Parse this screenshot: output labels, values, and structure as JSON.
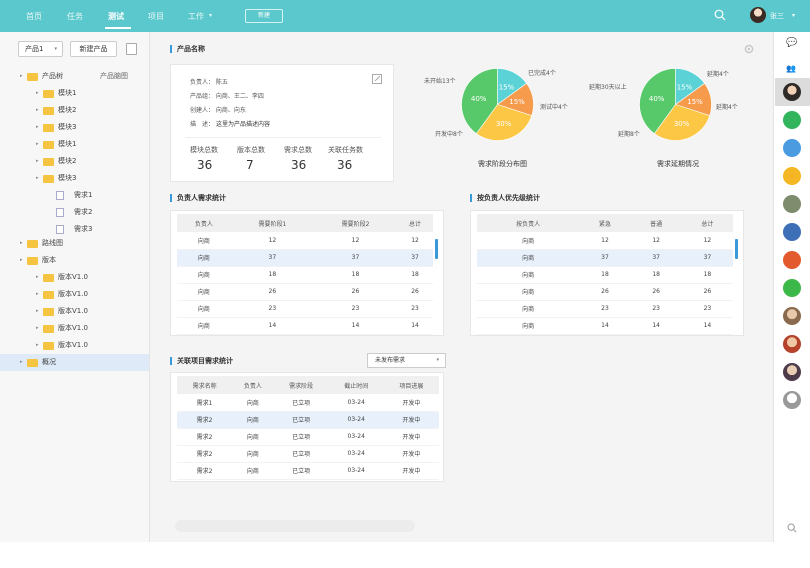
{
  "nav": {
    "items": [
      "首页",
      "任务",
      "测试",
      "项目",
      "工作"
    ],
    "active": "测试",
    "work_caret": "▾",
    "new_button": "新建",
    "user_name": "张三",
    "user_caret": "▾"
  },
  "sidebar": {
    "product_select": "产品1",
    "select_caret": "▾",
    "new_product_button": "新建产品",
    "tree": [
      {
        "label": "产品树",
        "level": 0,
        "type": "folder",
        "right": "产品脑图"
      },
      {
        "label": "模块1",
        "level": 1,
        "type": "folder"
      },
      {
        "label": "模块2",
        "level": 1,
        "type": "folder"
      },
      {
        "label": "模块3",
        "level": 1,
        "type": "folder"
      },
      {
        "label": "模块1",
        "level": 1,
        "type": "folder"
      },
      {
        "label": "模块2",
        "level": 1,
        "type": "folder"
      },
      {
        "label": "模块3",
        "level": 1,
        "type": "folder"
      },
      {
        "label": "需求1",
        "level": 2,
        "type": "file"
      },
      {
        "label": "需求2",
        "level": 2,
        "type": "file"
      },
      {
        "label": "需求3",
        "level": 2,
        "type": "file"
      },
      {
        "label": "路线图",
        "level": 0,
        "type": "folder"
      },
      {
        "label": "版本",
        "level": 0,
        "type": "folder"
      },
      {
        "label": "版本V1.0",
        "level": 1,
        "type": "folder"
      },
      {
        "label": "版本V1.0",
        "level": 1,
        "type": "folder"
      },
      {
        "label": "版本V1.0",
        "level": 1,
        "type": "folder"
      },
      {
        "label": "版本V1.0",
        "level": 1,
        "type": "folder"
      },
      {
        "label": "版本V1.0",
        "level": 1,
        "type": "folder"
      },
      {
        "label": "概况",
        "level": 0,
        "type": "folder",
        "selected": true
      }
    ]
  },
  "product": {
    "section_title": "产品名称",
    "owner": "负责人：   陈五",
    "group": "产品组：   向商、王二、李四",
    "creator": "创建人：   向商、向东",
    "desc_label": "描　述：",
    "desc_value": "这里为产品描述内容",
    "stats": [
      {
        "label": "模块总数",
        "value": "36"
      },
      {
        "label": "版本总数",
        "value": "7"
      },
      {
        "label": "需求总数",
        "value": "36"
      },
      {
        "label": "关联任务数",
        "value": "36"
      }
    ]
  },
  "pies": [
    {
      "caption": "需求阶段分布图",
      "slices": [
        {
          "label": "已完成4个",
          "pct": "15%",
          "value": 15,
          "color": "#5bd3d6"
        },
        {
          "label": "测试中4个",
          "pct": "15%",
          "value": 15,
          "color": "#f69a4c"
        },
        {
          "label": "开发中8个",
          "pct": "30%",
          "value": 30,
          "color": "#fcc745"
        },
        {
          "label": "未开始13个",
          "pct": "40%",
          "value": 40,
          "color": "#58c96b"
        }
      ]
    },
    {
      "caption": "需求延期情况",
      "slices": [
        {
          "label": "延期4个",
          "pct": "15%",
          "value": 15,
          "color": "#5bd3d6"
        },
        {
          "label": "延期4个",
          "pct": "15%",
          "value": 15,
          "color": "#f69a4c"
        },
        {
          "label": "延期8个",
          "pct": "30%",
          "value": 30,
          "color": "#fcc745"
        },
        {
          "label": "延期30天以上",
          "pct": "40%",
          "value": 40,
          "color": "#58c96b"
        }
      ]
    }
  ],
  "owner_table": {
    "title": "负责人需求统计",
    "headers": [
      "负责人",
      "需要阶段1",
      "需要阶段2",
      "总计"
    ],
    "rows": [
      [
        "向商",
        "12",
        "12",
        "12"
      ],
      [
        "向商",
        "37",
        "37",
        "37"
      ],
      [
        "向商",
        "18",
        "18",
        "18"
      ],
      [
        "向商",
        "26",
        "26",
        "26"
      ],
      [
        "向商",
        "23",
        "23",
        "23"
      ],
      [
        "向商",
        "14",
        "14",
        "14"
      ]
    ]
  },
  "priority_table": {
    "title": "按负责人优先级统计",
    "headers": [
      "按负责人",
      "紧急",
      "普通",
      "总计"
    ],
    "rows": [
      [
        "向商",
        "12",
        "12",
        "12"
      ],
      [
        "向商",
        "37",
        "37",
        "37"
      ],
      [
        "向商",
        "18",
        "18",
        "18"
      ],
      [
        "向商",
        "26",
        "26",
        "26"
      ],
      [
        "向商",
        "23",
        "23",
        "23"
      ],
      [
        "向商",
        "14",
        "14",
        "14"
      ]
    ]
  },
  "related_table": {
    "title": "关联项目需求统计",
    "filter": "未发布需求",
    "filter_caret": "▾",
    "headers": [
      "需求名称",
      "负责人",
      "需求阶段",
      "截止时间",
      "项目进展"
    ],
    "rows": [
      [
        "需求1",
        "向商",
        "已立项",
        "03-24",
        "开发中"
      ],
      [
        "需求2",
        "向商",
        "已立项",
        "03-24",
        "开发中"
      ],
      [
        "需求2",
        "向商",
        "已立项",
        "03-24",
        "开发中"
      ],
      [
        "需求2",
        "向商",
        "已立项",
        "03-24",
        "开发中"
      ],
      [
        "需求2",
        "向商",
        "已立项",
        "03-24",
        "开发中"
      ]
    ]
  }
}
